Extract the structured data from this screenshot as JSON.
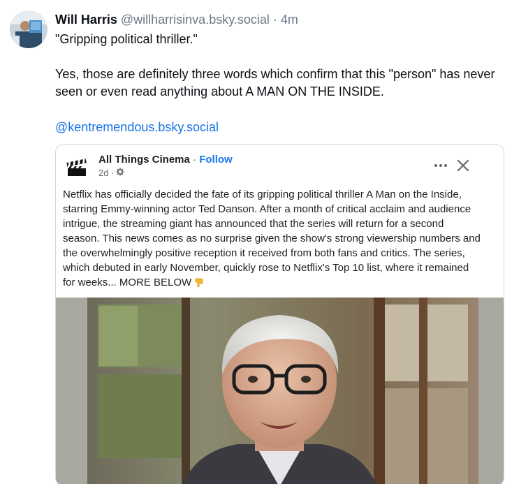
{
  "post": {
    "author": "Will Harris",
    "handle": "@willharrisinva.bsky.social",
    "separator": "·",
    "time": "4m",
    "text_line1": "\"Gripping political thriller.\"",
    "text_para2": "Yes, those are definitely three words which confirm that this \"person\" has never seen or even read anything about A MAN ON THE INSIDE.",
    "mention": "@kentremendous.bsky.social"
  },
  "embed": {
    "page_name": "All Things Cinema",
    "name_separator": " · ",
    "follow_label": "Follow",
    "age": "2d ·",
    "body": "Netflix has officially decided the fate of its gripping political thriller A Man on the Inside, starring Emmy-winning actor Ted Danson. After a month of critical acclaim and audience intrigue, the streaming giant has announced that the series will return for a second season. This news comes as no surprise given the show's strong viewership numbers and the overwhelmingly positive reception it received from both fans and critics. The series, which debuted in early November, quickly rose to Netflix's Top 10 list, where it remained for weeks... MORE BELOW",
    "icons": {
      "more": "more-horizontal-icon",
      "close": "close-icon",
      "privacy": "gear-icon",
      "avatar": "clapperboard-icon",
      "pointer": "pointing-down-emoji"
    }
  },
  "colors": {
    "link": "#1a73e8",
    "follow": "#1877f2",
    "muted": "#6b7785"
  }
}
